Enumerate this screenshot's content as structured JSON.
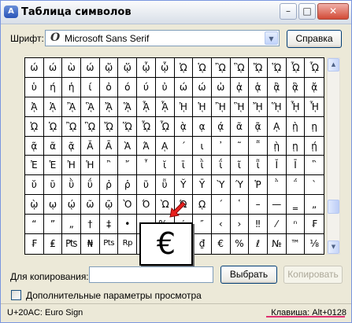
{
  "window": {
    "title": "Таблица символов",
    "icon_letter": "A",
    "controls": [
      "minimize-icon",
      "maximize-icon",
      "close-icon"
    ],
    "control_glyphs": {
      "minimize": "–",
      "maximize": "□",
      "close": "✕"
    }
  },
  "font_row": {
    "label": "Шрифт:",
    "font_icon": "O",
    "selected_font": "Microsoft Sans Serif",
    "dropdown_arrow": "▼",
    "help_button": "Справка"
  },
  "grid": {
    "rows": [
      [
        "ώ",
        "ώ",
        "ὼ",
        "ώ",
        "ᾤ",
        "ᾥ",
        "ᾦ",
        "ᾧ",
        "ᾨ",
        "ᾩ",
        "ᾪ",
        "ᾫ",
        "ᾬ",
        "ᾭ",
        "ᾮ",
        "ᾯ"
      ],
      [
        "ὑ",
        "ή",
        "ἡ",
        "ί",
        "ὀ",
        "ό",
        "ύ",
        "ὐ",
        "ώ",
        "ώ",
        "ὠ",
        "ᾀ",
        "ᾁ",
        "ᾂ",
        "ᾃ",
        "ᾄ"
      ],
      [
        "ᾈ",
        "ᾉ",
        "ᾊ",
        "ᾋ",
        "ᾌ",
        "ᾍ",
        "ᾎ",
        "ᾏ",
        "ᾘ",
        "ᾙ",
        "ᾚ",
        "ᾛ",
        "ᾜ",
        "ᾝ",
        "ᾞ",
        "ᾟ"
      ],
      [
        "ᾨ",
        "ᾩ",
        "ᾪ",
        "ᾫ",
        "ᾬ",
        "ᾭ",
        "ᾮ",
        "ᾯ",
        "ᾲ",
        "ᾳ",
        "ᾴ",
        "ᾶ",
        "ᾷ",
        "ᾼ",
        "ῂ",
        "ῃ"
      ],
      [
        "ᾷ",
        "ᾶ",
        "ᾷ",
        "Ᾰ",
        "Ᾱ",
        "Ὰ",
        "Ά",
        "ᾼ",
        "´",
        "ι",
        "᾿",
        "῀",
        "῁",
        "ῂ",
        "ῃ",
        "ῄ"
      ],
      [
        "Ἐ",
        "Ἑ",
        "Ἠ",
        "Ἡ",
        "῍",
        "῎",
        "῏",
        "ῐ",
        "ῑ",
        "ῒ",
        "ΐ",
        "ῖ",
        "ῗ",
        "Ῐ",
        "Ῑ",
        "῝"
      ],
      [
        "ῠ",
        "ῡ",
        "ῢ",
        "ΰ",
        "ῤ",
        "ῥ",
        "ῦ",
        "ῧ",
        "Ῠ",
        "Ῡ",
        "Ὺ",
        "Ύ",
        "Ῥ",
        "῭",
        "΅",
        "`"
      ],
      [
        "ῲ",
        "ῳ",
        "ῴ",
        "ῶ",
        "ῷ",
        "Ὸ",
        "Ό",
        "Ὼ",
        "Ώ",
        "ῼ",
        "´",
        "῾",
        "–",
        "—",
        "‗",
        "„"
      ],
      [
        "“",
        "”",
        "„",
        "†",
        "‡",
        "•",
        "…",
        "‰",
        "′",
        "″",
        "‹",
        "›",
        "‼",
        "⁄",
        "ⁿ",
        "₣"
      ],
      [
        "₣",
        "₤",
        "₧",
        "₦",
        "Pts",
        "Rp",
        "₩",
        "₪",
        "",
        "₫",
        "€",
        "%",
        "ℓ",
        "№",
        "™",
        "⅛"
      ]
    ],
    "zoom_char": "€"
  },
  "scrollbar": {
    "up": "▲",
    "down": "▼"
  },
  "copy_row": {
    "label": "Для копирования:",
    "value": "",
    "select_button": "Выбрать",
    "copy_button": "Копировать"
  },
  "advanced": {
    "checked": false,
    "label": "Дополнительные параметры просмотра"
  },
  "status": {
    "left": "U+20AC: Euro Sign",
    "right": "Клавиша: Alt+0128"
  },
  "colors": {
    "window_bg": "#ece9d8",
    "accent": "#e03070",
    "pointer": "#e8201e"
  }
}
